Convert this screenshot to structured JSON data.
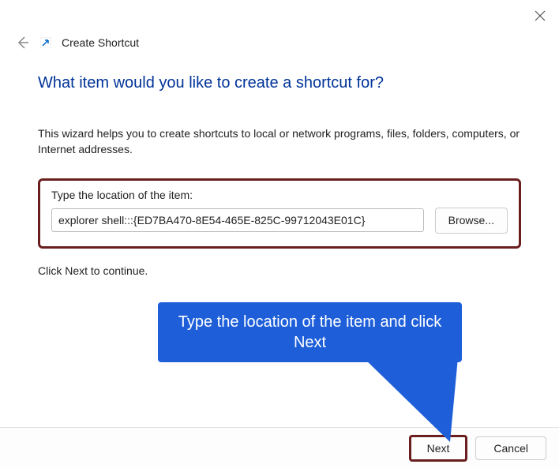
{
  "titlebar": {
    "close_icon": "close"
  },
  "header": {
    "window_title": "Create Shortcut"
  },
  "main": {
    "heading": "What item would you like to create a shortcut for?",
    "description": "This wizard helps you to create shortcuts to local or network programs, files, folders, computers, or Internet addresses.",
    "input_label": "Type the location of the item:",
    "input_value": "explorer shell:::{ED7BA470-8E54-465E-825C-99712043E01C}",
    "browse_label": "Browse...",
    "continue_text": "Click Next to continue."
  },
  "callout": {
    "text": "Type the location of the item and click Next"
  },
  "footer": {
    "next_label": "Next",
    "cancel_label": "Cancel"
  },
  "colors": {
    "highlight_border": "#6b1e1e",
    "callout_bg": "#1e5fd9",
    "heading_color": "#003399"
  }
}
